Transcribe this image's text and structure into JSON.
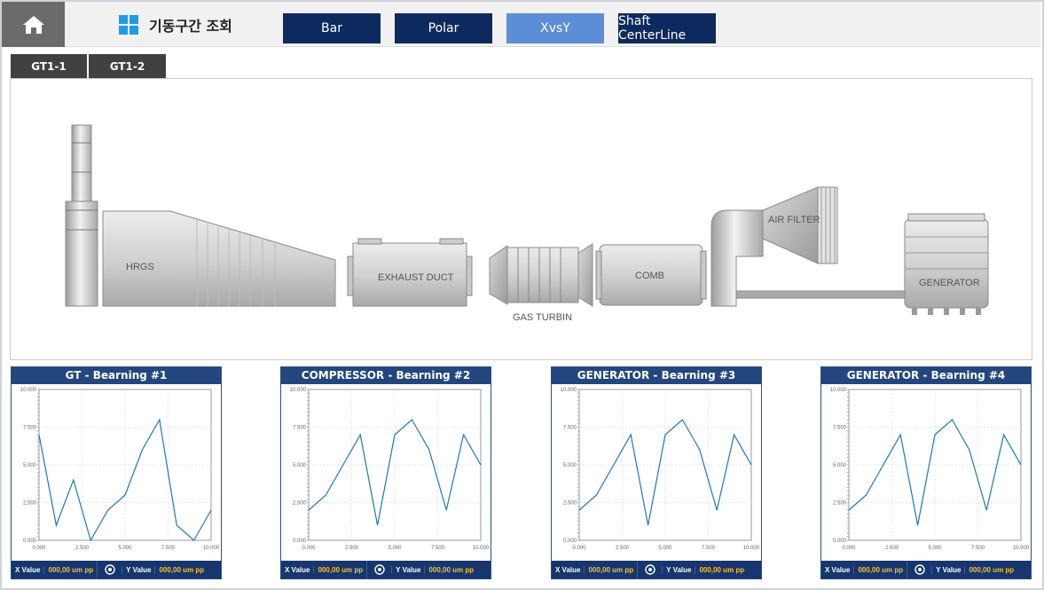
{
  "header": {
    "home_icon": "home-icon",
    "grid_icon": "grid-icon",
    "title": "기동구간 조회"
  },
  "nav_buttons": [
    {
      "label": "Bar",
      "active": false
    },
    {
      "label": "Polar",
      "active": false
    },
    {
      "label": "XvsY",
      "active": true
    },
    {
      "label": "Shaft CenterLine",
      "active": false
    }
  ],
  "tabs": [
    {
      "label": "GT1-1"
    },
    {
      "label": "GT1-2"
    }
  ],
  "diagram": {
    "labels": {
      "hrgs": "HRGS",
      "exhaust_duct": "EXHAUST DUCT",
      "gas_turbin": "GAS TURBIN",
      "comb": "COMB",
      "air_filter": "AIR FILTER",
      "generator": "GENERATOR"
    }
  },
  "footer": {
    "x_label": "X Value",
    "x_value": "000,00 um pp",
    "y_label": "Y Value",
    "y_value": "000,00 um pp",
    "icon": "settings-circle-icon"
  },
  "chart_data": [
    {
      "type": "line",
      "title": "GT - Bearning #1",
      "x": [
        0,
        1,
        2,
        3,
        4,
        5,
        6,
        7,
        8,
        9,
        10
      ],
      "y": [
        7,
        1,
        4,
        0,
        2,
        3,
        6,
        8,
        1,
        0,
        2
      ],
      "xlim": [
        0,
        10
      ],
      "ylim": [
        0,
        10
      ],
      "x_ticks": [
        "0.000",
        "2.500",
        "5.000",
        "7.500",
        "10.000"
      ],
      "y_ticks": [
        "0.000",
        "2.500",
        "5.000",
        "7.500",
        "10.000"
      ],
      "grid": true,
      "color": "#1f77b4"
    },
    {
      "type": "line",
      "title": "COMPRESSOR - Bearning #2",
      "x": [
        0,
        1,
        2,
        3,
        4,
        5,
        6,
        7,
        8,
        9,
        10
      ],
      "y": [
        2,
        3,
        5,
        7,
        1,
        7,
        8,
        6,
        2,
        7,
        5
      ],
      "xlim": [
        0,
        10
      ],
      "ylim": [
        0,
        10
      ],
      "x_ticks": [
        "0.000",
        "2.500",
        "5.000",
        "7.500",
        "10.000"
      ],
      "y_ticks": [
        "0.000",
        "2.500",
        "5.000",
        "7.500",
        "10.000"
      ],
      "grid": true,
      "color": "#1f77b4"
    },
    {
      "type": "line",
      "title": "GENERATOR - Bearning #3",
      "x": [
        0,
        1,
        2,
        3,
        4,
        5,
        6,
        7,
        8,
        9,
        10
      ],
      "y": [
        2,
        3,
        5,
        7,
        1,
        7,
        8,
        6,
        2,
        7,
        5
      ],
      "xlim": [
        0,
        10
      ],
      "ylim": [
        0,
        10
      ],
      "x_ticks": [
        "0.000",
        "2.500",
        "5.000",
        "7.500",
        "10.000"
      ],
      "y_ticks": [
        "0.000",
        "2.500",
        "5.000",
        "7.500",
        "10.000"
      ],
      "grid": true,
      "color": "#1f77b4"
    },
    {
      "type": "line",
      "title": "GENERATOR - Bearning #4",
      "x": [
        0,
        1,
        2,
        3,
        4,
        5,
        6,
        7,
        8,
        9,
        10
      ],
      "y": [
        2,
        3,
        5,
        7,
        1,
        7,
        8,
        6,
        2,
        7,
        5
      ],
      "xlim": [
        0,
        10
      ],
      "ylim": [
        0,
        10
      ],
      "x_ticks": [
        "0.000",
        "2.500",
        "5.000",
        "7.500",
        "10.000"
      ],
      "y_ticks": [
        "0.000",
        "2.500",
        "5.000",
        "7.500",
        "10.000"
      ],
      "grid": true,
      "color": "#1f77b4"
    }
  ]
}
